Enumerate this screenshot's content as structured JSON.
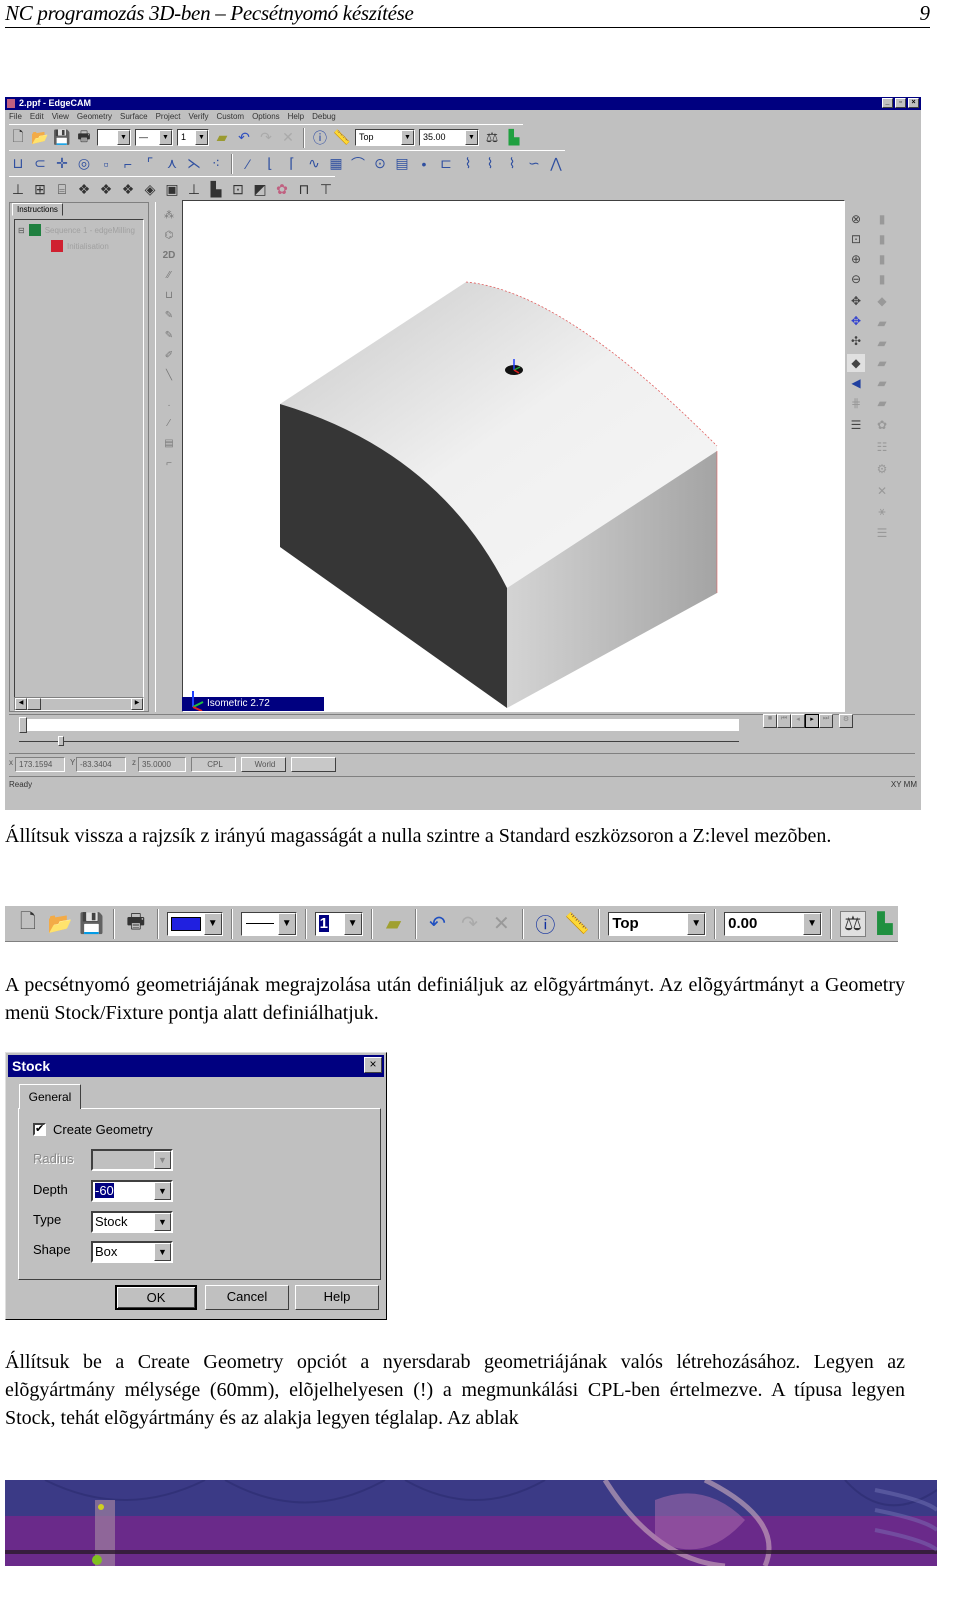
{
  "page_header": {
    "title": "NC programozás 3D-ben – Pecsétnyomó készítése",
    "page_number": "9"
  },
  "app_window": {
    "title": "2.ppf - EdgeCAM",
    "menu": [
      "File",
      "Edit",
      "View",
      "Geometry",
      "Surface",
      "Project",
      "Verify",
      "Custom",
      "Options",
      "Help",
      "Debug"
    ],
    "toolbar": {
      "view_value": "Top",
      "zlevel_value": "35.00",
      "layer_value": "1"
    },
    "instructions_tab": "Instructions",
    "tree_items": [
      "Sequence 1 - edgeMilling",
      "Initialisation"
    ],
    "viewport_label": "Isometric 2.72",
    "coords": {
      "x": "173.1594",
      "y": "-83.3404",
      "z": "35.0000"
    },
    "cpl_button": "CPL",
    "world_button": "World",
    "status": "Ready",
    "status_right": "XY MM"
  },
  "para1": "Állítsuk vissza a rajzsík z irányú magasságát a nulla szintre a Standard eszközsoron a Z:level mezõben.",
  "standard_toolbar": {
    "color_value": "#2020e0",
    "layer_value": "1",
    "view_value": "Top",
    "zlevel_value": "0.00"
  },
  "para2": "A pecsétnyomó geometriájának megrajzolása után definiáljuk az elõgyártmányt. Az elõgyártmányt a Geometry menü Stock/Fixture pontja alatt definiálhatjuk.",
  "stock_dialog": {
    "title": "Stock",
    "tab": "General",
    "create_geometry_label": "Create Geometry",
    "create_geometry_checked": true,
    "radius_label": "Radius",
    "radius_value": "",
    "depth_label": "Depth",
    "depth_value": "-60",
    "type_label": "Type",
    "type_value": "Stock",
    "shape_label": "Shape",
    "shape_value": "Box",
    "ok": "OK",
    "cancel": "Cancel",
    "help": "Help"
  },
  "para3": "Állítsuk be a Create Geometry opciót a nyersdarab geometriájának valós létrehozásához. Legyen az elõgyártmány mélysége (60mm), elõjelhelyesen (!) a megmunkálási CPL-ben értelmezve. A típusa legyen Stock, tehát elõgyártmány és az alakja legyen téglalap. Az ablak"
}
